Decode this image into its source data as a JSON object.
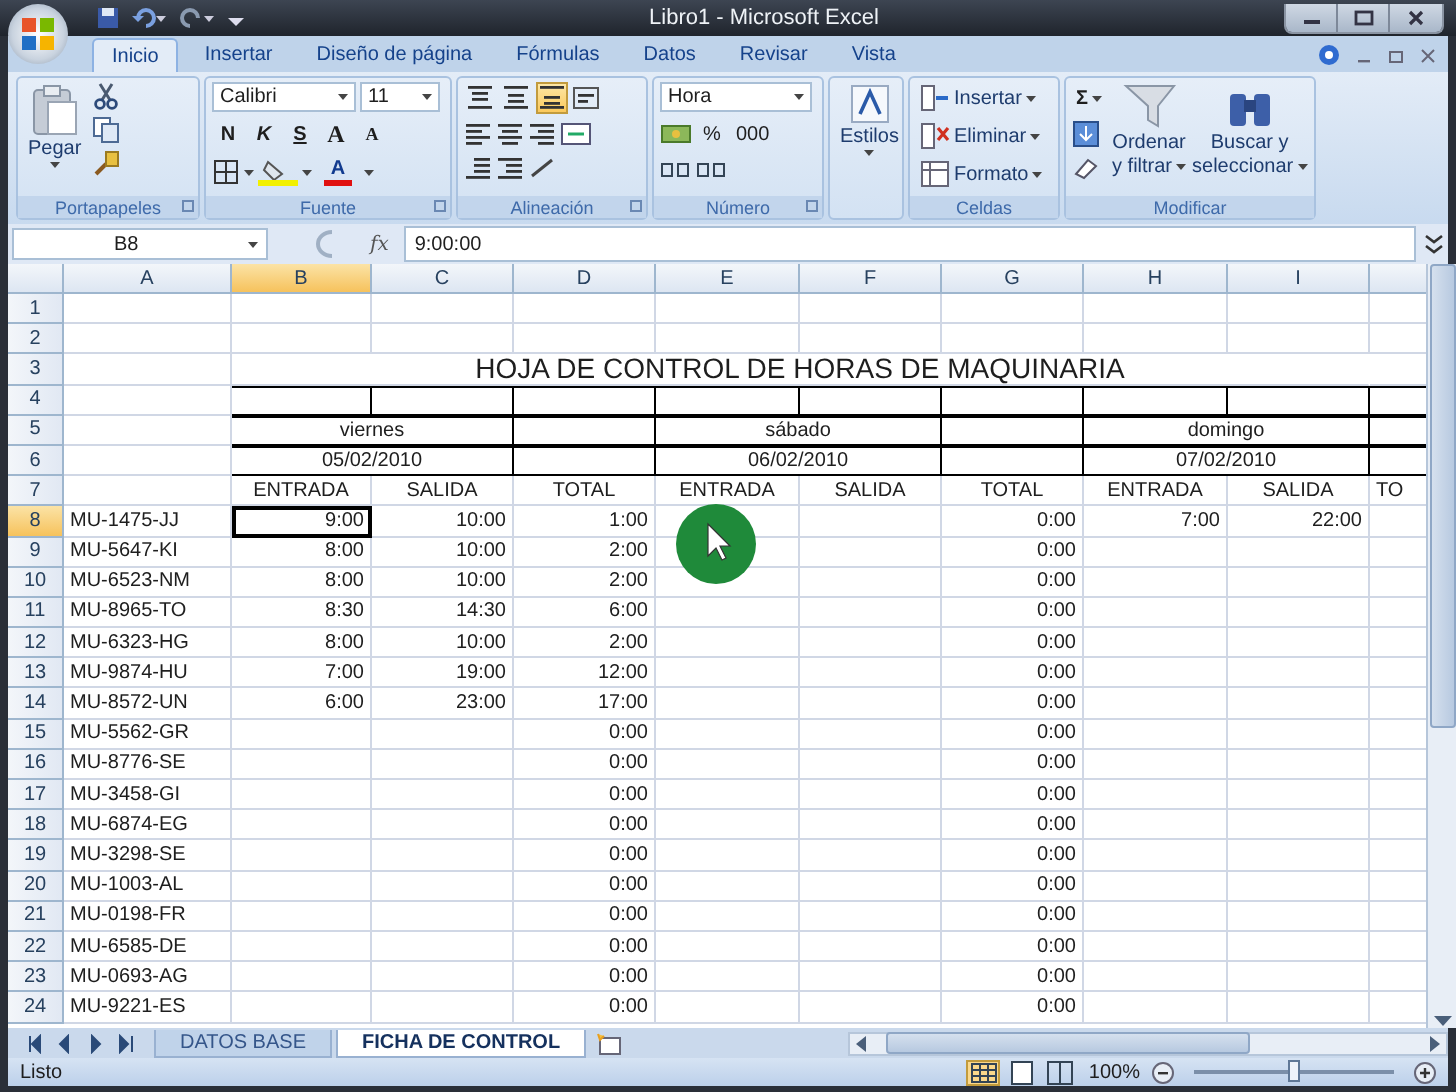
{
  "window": {
    "title": "Libro1 - Microsoft Excel"
  },
  "ribbon_tabs": [
    {
      "label": "Inicio",
      "selected": true
    },
    {
      "label": "Insertar",
      "selected": false
    },
    {
      "label": "Diseño de página",
      "selected": false
    },
    {
      "label": "Fórmulas",
      "selected": false
    },
    {
      "label": "Datos",
      "selected": false
    },
    {
      "label": "Revisar",
      "selected": false
    },
    {
      "label": "Vista",
      "selected": false
    }
  ],
  "ribbon": {
    "clipboard": {
      "label": "Portapapeles",
      "paste": "Pegar"
    },
    "font": {
      "label": "Fuente",
      "font": "Calibri",
      "size": "11",
      "styles": [
        {
          "label": "N",
          "kind": "bold"
        },
        {
          "label": "K",
          "kind": "italic"
        },
        {
          "label": "S",
          "kind": "underline"
        }
      ],
      "grow": "A",
      "shrink": "A",
      "color_letter": "A"
    },
    "alignment": {
      "label": "Alineación",
      "vertical": [
        {
          "selected": false
        },
        {
          "selected": false
        },
        {
          "selected": true
        }
      ]
    },
    "number": {
      "label": "Número",
      "format": "Hora",
      "symbols": [
        "%",
        "000"
      ]
    },
    "styles": {
      "label": "Estilos"
    },
    "cells": {
      "label": "Celdas",
      "items": [
        "Insertar",
        "Eliminar",
        "Formato"
      ]
    },
    "editing": {
      "label": "Modificar",
      "sum": "Σ",
      "sort": [
        "Ordenar",
        "y filtrar"
      ],
      "find": [
        "Buscar y",
        "seleccionar"
      ]
    }
  },
  "formula_bar": {
    "name_box": "B8",
    "fx": "fx",
    "value": "9:00:00"
  },
  "sheet": {
    "columns": [
      {
        "label": "A",
        "selected": false
      },
      {
        "label": "B",
        "selected": true
      },
      {
        "label": "C",
        "selected": false
      },
      {
        "label": "D",
        "selected": false
      },
      {
        "label": "E",
        "selected": false
      },
      {
        "label": "F",
        "selected": false
      },
      {
        "label": "G",
        "selected": false
      },
      {
        "label": "H",
        "selected": false
      },
      {
        "label": "I",
        "selected": false
      },
      {
        "selected": false
      }
    ],
    "rows": [
      {
        "number": "1",
        "kind": "blank",
        "selected": false,
        "cells": []
      },
      {
        "number": "2",
        "kind": "blank",
        "selected": false,
        "cells": []
      },
      {
        "number": "3",
        "kind": "title",
        "selected": false,
        "title": "HOJA DE CONTROL DE HORAS DE MAQUINARIA"
      },
      {
        "number": "4",
        "kind": "boxed",
        "selected": false,
        "cells": []
      },
      {
        "number": "5",
        "kind": "merged",
        "selected": false,
        "cells": [
          "",
          "viernes",
          "",
          "sábado",
          "",
          "domingo",
          ""
        ]
      },
      {
        "number": "6",
        "kind": "merged",
        "selected": false,
        "cells": [
          "",
          "05/02/2010",
          "",
          "06/02/2010",
          "",
          "07/02/2010",
          ""
        ]
      },
      {
        "number": "7",
        "kind": "header",
        "selected": false,
        "cells": [
          "",
          "ENTRADA",
          "SALIDA",
          "TOTAL",
          "ENTRADA",
          "SALIDA",
          "TOTAL",
          "ENTRADA",
          "SALIDA",
          "TO"
        ]
      },
      {
        "number": "8",
        "kind": "data",
        "selected": true,
        "cells": [
          "MU-1475-JJ",
          "9:00",
          "10:00",
          "1:00",
          "",
          "",
          "0:00",
          "7:00",
          "22:00"
        ]
      },
      {
        "number": "9",
        "kind": "data",
        "selected": false,
        "cells": [
          "MU-5647-KI",
          "8:00",
          "10:00",
          "2:00",
          "",
          "",
          "0:00"
        ]
      },
      {
        "number": "10",
        "kind": "data",
        "selected": false,
        "cells": [
          "MU-6523-NM",
          "8:00",
          "10:00",
          "2:00",
          "",
          "",
          "0:00"
        ]
      },
      {
        "number": "11",
        "kind": "data",
        "selected": false,
        "cells": [
          "MU-8965-TO",
          "8:30",
          "14:30",
          "6:00",
          "",
          "",
          "0:00"
        ]
      },
      {
        "number": "12",
        "kind": "data",
        "selected": false,
        "cells": [
          "MU-6323-HG",
          "8:00",
          "10:00",
          "2:00",
          "",
          "",
          "0:00"
        ]
      },
      {
        "number": "13",
        "kind": "data",
        "selected": false,
        "cells": [
          "MU-9874-HU",
          "7:00",
          "19:00",
          "12:00",
          "",
          "",
          "0:00"
        ]
      },
      {
        "number": "14",
        "kind": "data",
        "selected": false,
        "cells": [
          "MU-8572-UN",
          "6:00",
          "23:00",
          "17:00",
          "",
          "",
          "0:00"
        ]
      },
      {
        "number": "15",
        "kind": "data",
        "selected": false,
        "cells": [
          "MU-5562-GR",
          "",
          "",
          "0:00",
          "",
          "",
          "0:00"
        ]
      },
      {
        "number": "16",
        "kind": "data",
        "selected": false,
        "cells": [
          "MU-8776-SE",
          "",
          "",
          "0:00",
          "",
          "",
          "0:00"
        ]
      },
      {
        "number": "17",
        "kind": "data",
        "selected": false,
        "cells": [
          "MU-3458-GI",
          "",
          "",
          "0:00",
          "",
          "",
          "0:00"
        ]
      },
      {
        "number": "18",
        "kind": "data",
        "selected": false,
        "cells": [
          "MU-6874-EG",
          "",
          "",
          "0:00",
          "",
          "",
          "0:00"
        ]
      },
      {
        "number": "19",
        "kind": "data",
        "selected": false,
        "cells": [
          "MU-3298-SE",
          "",
          "",
          "0:00",
          "",
          "",
          "0:00"
        ]
      },
      {
        "number": "20",
        "kind": "data",
        "selected": false,
        "cells": [
          "MU-1003-AL",
          "",
          "",
          "0:00",
          "",
          "",
          "0:00"
        ]
      },
      {
        "number": "21",
        "kind": "data",
        "selected": false,
        "cells": [
          "MU-0198-FR",
          "",
          "",
          "0:00",
          "",
          "",
          "0:00"
        ]
      },
      {
        "number": "22",
        "kind": "data",
        "selected": false,
        "cells": [
          "MU-6585-DE",
          "",
          "",
          "0:00",
          "",
          "",
          "0:00"
        ]
      },
      {
        "number": "23",
        "kind": "data",
        "selected": false,
        "cells": [
          "MU-0693-AG",
          "",
          "",
          "0:00",
          "",
          "",
          "0:00"
        ]
      },
      {
        "number": "24",
        "kind": "data",
        "selected": false,
        "cells": [
          "MU-9221-ES",
          "",
          "",
          "0:00",
          "",
          "",
          "0:00"
        ]
      }
    ]
  },
  "sheet_tabs": [
    {
      "label": "DATOS BASE",
      "selected": false
    },
    {
      "label": "FICHA DE CONTROL",
      "selected": true
    }
  ],
  "status_bar": {
    "status": "Listo",
    "views": [
      {
        "selected": true
      },
      {
        "selected": false
      },
      {
        "selected": false
      }
    ],
    "zoom": "100%",
    "zoom_slider": {
      "level": 0.5
    }
  }
}
